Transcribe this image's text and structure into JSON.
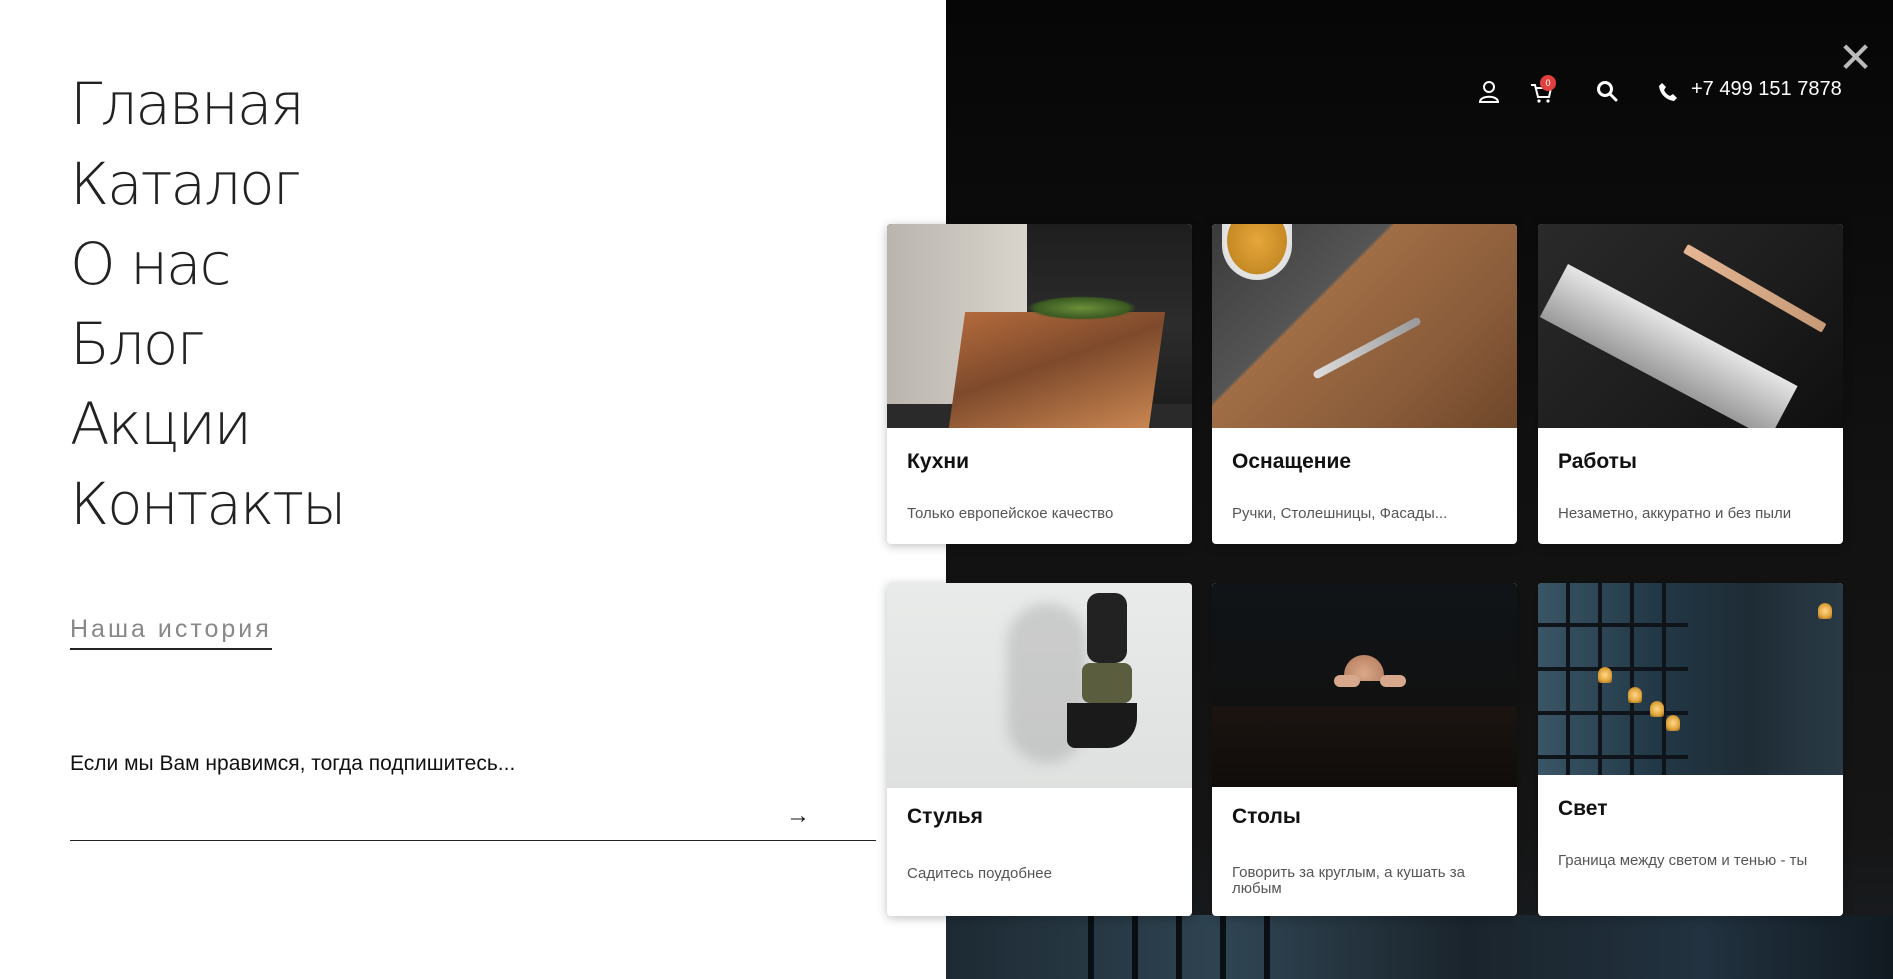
{
  "menu": {
    "items": [
      "Главная",
      "Каталог",
      "О нас",
      "Блог",
      "Акции",
      "Контакты"
    ],
    "story_link": "Наша история"
  },
  "subscribe": {
    "text": "Если мы Вам нравимся, тогда подпишитесь...",
    "placeholder": "",
    "arrow": "→"
  },
  "header": {
    "phone": "+7 499 151 7878",
    "cart_count": "0",
    "icons": [
      "user-icon",
      "cart-icon",
      "search-icon",
      "phone-icon",
      "close-icon"
    ]
  },
  "cards": [
    {
      "title": "Кухни",
      "desc": "Только европейское качество"
    },
    {
      "title": "Оснащение",
      "desc": "Ручки, Столешницы, Фасады..."
    },
    {
      "title": "Работы",
      "desc": "Незаметно, аккуратно и без пыли"
    },
    {
      "title": "Стулья",
      "desc": "Садитесь поудобнее"
    },
    {
      "title": "Столы",
      "desc": "Говорить за круглым, а кушать за любым"
    },
    {
      "title": "Свет",
      "desc": "Граница между светом и тенью - ты"
    }
  ],
  "colors": {
    "accent_badge": "#e0413e",
    "dark_panel": "#0b0b0b",
    "text": "#222222"
  }
}
